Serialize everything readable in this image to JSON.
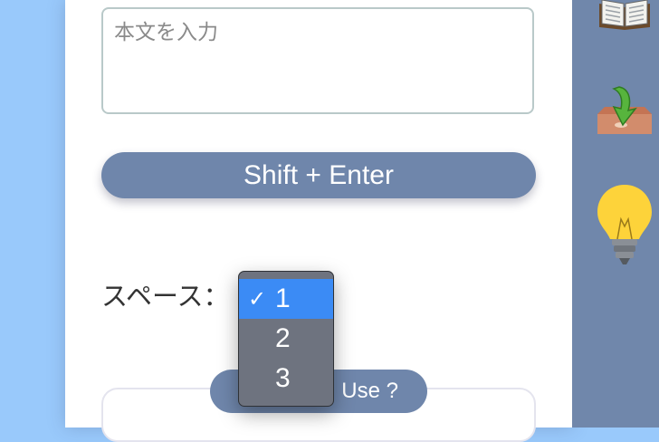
{
  "editor": {
    "placeholder": "本文を入力"
  },
  "shift_button": {
    "label": "Shift + Enter"
  },
  "spacing": {
    "label": "スペース：",
    "options": [
      "1",
      "2",
      "3"
    ],
    "selected": "1",
    "check_glyph": "✓"
  },
  "howto_button": {
    "label_visible": "Use ?"
  },
  "sidebar": {
    "icons": [
      "book-icon",
      "download-tray-icon",
      "lightbulb-icon"
    ]
  },
  "colors": {
    "page_bg": "#99c9fb",
    "accent": "#6f86ab",
    "sidebar": "#7087ab",
    "dropdown_bg": "#6e737f",
    "dropdown_selected": "#3b8bf5"
  }
}
